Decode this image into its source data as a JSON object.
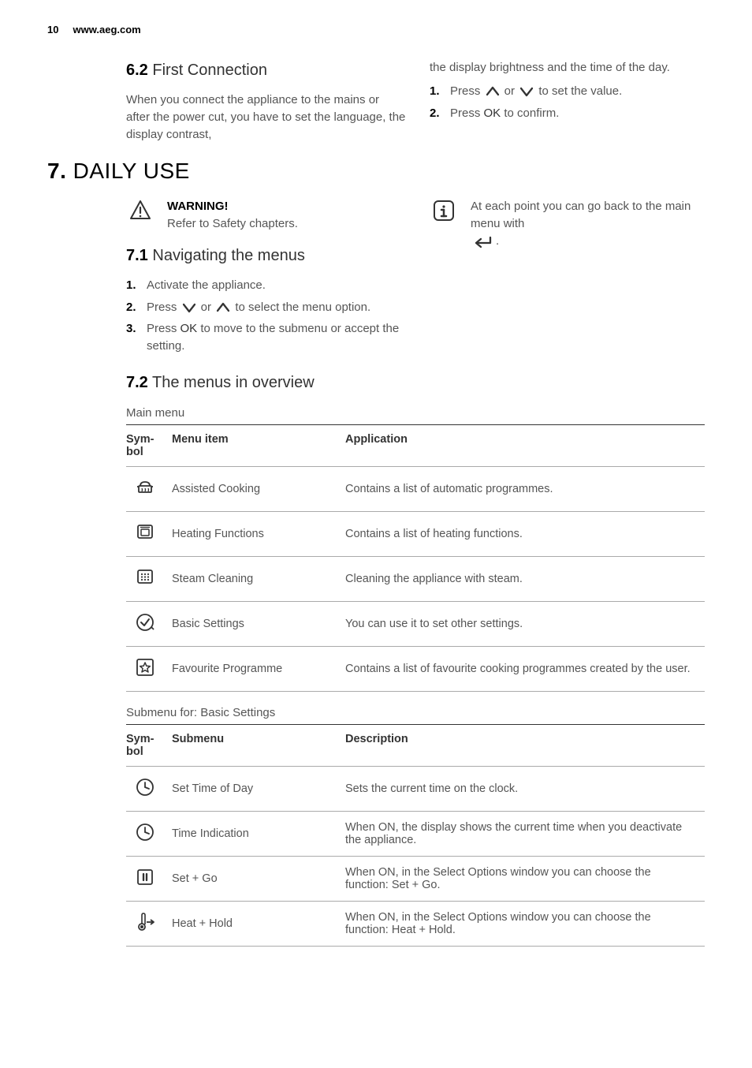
{
  "page_header": {
    "page_num": "10",
    "site": "www.aeg.com"
  },
  "sec_6_2": {
    "title_num": "6.2",
    "title_text": "First Connection",
    "para_left": "When you connect the appliance to the mains or after the power cut, you have to set the language, the display contrast,",
    "para_right_top": "the display brightness and the time of the day.",
    "step1_before": "Press ",
    "step1_mid": " or ",
    "step1_after": " to set the value.",
    "step2_before": "Press ",
    "step2_after": " to confirm.",
    "ok_label": "OK"
  },
  "sec_7": {
    "title_num": "7.",
    "title_text": " DAILY USE",
    "warning_label": "WARNING!",
    "warning_text": "Refer to Safety chapters.",
    "info_text_1": "At each point you can go back to the main menu with ",
    "info_text_2": "."
  },
  "sec_7_1": {
    "title_num": "7.1",
    "title_text": "Navigating the menus",
    "step1": "Activate the appliance.",
    "step2_before": "Press ",
    "step2_mid": " or ",
    "step2_after": " to select the menu option.",
    "step3_before": "Press ",
    "step3_after": " to move to the submenu or accept the setting.",
    "ok_label": "OK"
  },
  "sec_7_2": {
    "title_num": "7.2",
    "title_text": "The menus in overview",
    "table1_title": "Main menu",
    "table1_headers": {
      "h1": "Sym-\nbol",
      "h2": "Menu item",
      "h3": "Application"
    },
    "table1_rows": [
      {
        "icon": "pot",
        "item": "Assisted Cooking",
        "app": "Contains a list of automatic programmes."
      },
      {
        "icon": "oven",
        "item": "Heating Functions",
        "app": "Contains a list of heating functions."
      },
      {
        "icon": "steam-grid",
        "item": "Steam Cleaning",
        "app": "Cleaning the appliance with steam."
      },
      {
        "icon": "check-clock",
        "item": "Basic Settings",
        "app": "You can use it to set other settings."
      },
      {
        "icon": "star-box",
        "item": "Favourite Programme",
        "app": "Contains a list of favourite cooking programmes created by the user."
      }
    ],
    "table2_title": "Submenu for: Basic Settings",
    "table2_headers": {
      "h1": "Sym-\nbol",
      "h2": "Submenu",
      "h3": "Description"
    },
    "table2_rows": [
      {
        "icon": "clock",
        "item": "Set Time of Day",
        "app": "Sets the current time on the clock."
      },
      {
        "icon": "clock",
        "item": "Time Indication",
        "app": "When ON, the display shows the current time when you deactivate the appliance."
      },
      {
        "icon": "pause-box",
        "item": "Set + Go",
        "app": "When ON, in the Select Options window you can choose the function: Set + Go."
      },
      {
        "icon": "thermo-arrow",
        "item": "Heat + Hold",
        "app": "When ON, in the Select Options window you can choose the function: Heat + Hold."
      }
    ]
  }
}
